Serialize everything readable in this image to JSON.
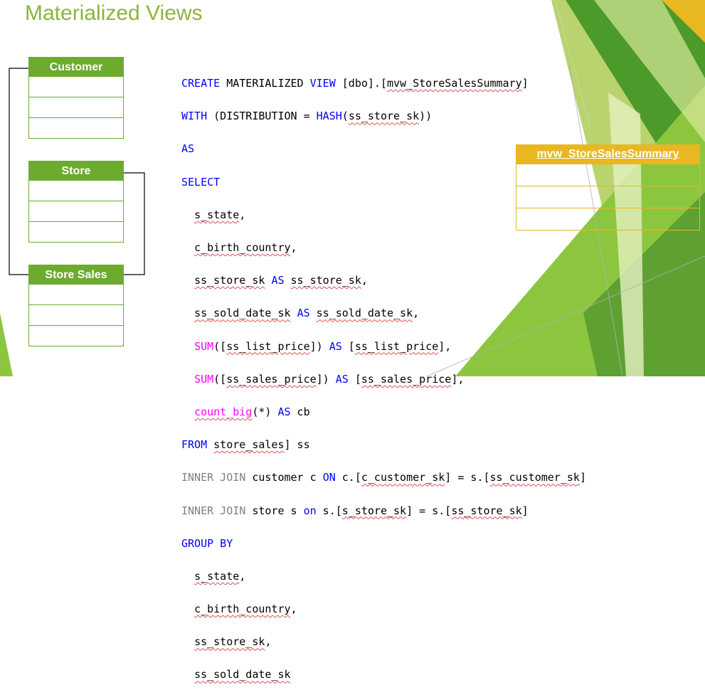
{
  "title": "Materialized Views",
  "tables": [
    {
      "name": "Customer"
    },
    {
      "name": "Store"
    },
    {
      "name": "Store Sales"
    }
  ],
  "result_table": {
    "name": "mvw_StoreSalesSummary"
  },
  "sql": {
    "line1": {
      "kw1": "CREATE",
      "t1": " MATERIALIZED ",
      "kw2": "VIEW",
      "t2": " [dbo].[",
      "id": "mvw_StoreSalesSummary",
      "t3": "]"
    },
    "line2": {
      "kw1": "WITH",
      "t1": " (DISTRIBUTION = ",
      "kw2": "HASH",
      "t2": "(",
      "id": "ss_store_sk",
      "t3": "))"
    },
    "line3": {
      "kw": "AS"
    },
    "line4": {
      "kw": "SELECT"
    },
    "line5": {
      "indent": "  ",
      "id": "s_state",
      "t1": ","
    },
    "line6": {
      "indent": "  ",
      "id": "c_birth_country",
      "t1": ","
    },
    "line7": {
      "indent": "  ",
      "id1": "ss_store_sk",
      "t1": " ",
      "kw": "AS",
      "t2": " ",
      "id2": "ss_store_sk",
      "t3": ","
    },
    "line8": {
      "indent": "  ",
      "id1": "ss_sold_date_sk",
      "t1": " ",
      "kw": "AS",
      "t2": " ",
      "id2": "ss_sold_date_sk",
      "t3": ","
    },
    "line9": {
      "indent": "  ",
      "fn": "SUM",
      "t1": "([",
      "id1": "ss_list_price",
      "t2": "]) ",
      "kw": "AS",
      "t3": " [",
      "id2": "ss_list_price",
      "t4": "],"
    },
    "line10": {
      "indent": "  ",
      "fn": "SUM",
      "t1": "([",
      "id1": "ss_sales_price",
      "t2": "]) ",
      "kw": "AS",
      "t3": " [",
      "id2": "ss_sales_price",
      "t4": "],"
    },
    "line11": {
      "indent": "  ",
      "fn": "count_big",
      "t1": "(*) ",
      "kw": "AS",
      "t2": " cb"
    },
    "line12": {
      "kw": "FROM",
      "t1": " ",
      "id": "store_sales",
      "t2": "] ss"
    },
    "line13": {
      "gray": "INNER JOIN",
      "t1": " customer c ",
      "kw": "ON",
      "t2": " c.[",
      "id1": "c_customer_sk",
      "t3": "] = s.[",
      "id2": "ss_customer_sk",
      "t4": "]"
    },
    "line14": {
      "gray": "INNER JOIN",
      "t1": " store s ",
      "kw": "on",
      "t2": " s.[",
      "id1": "s_store_sk",
      "t3": "] = s.[",
      "id2": "ss_store_sk",
      "t4": "]"
    },
    "line15": {
      "kw": "GROUP BY"
    },
    "line16": {
      "indent": "  ",
      "id": "s_state",
      "t1": ","
    },
    "line17": {
      "indent": "  ",
      "id": "c_birth_country",
      "t1": ","
    },
    "line18": {
      "indent": "  ",
      "id": "ss_store_sk",
      "t1": ","
    },
    "line19": {
      "indent": "  ",
      "id": "ss_sold_date_sk"
    }
  },
  "colors": {
    "title": "#8cb43d",
    "table_header": "#6cab2e",
    "result_header": "#e8b722",
    "keyword": "#0000ff",
    "function": "#ff00ff",
    "join": "#808080"
  }
}
